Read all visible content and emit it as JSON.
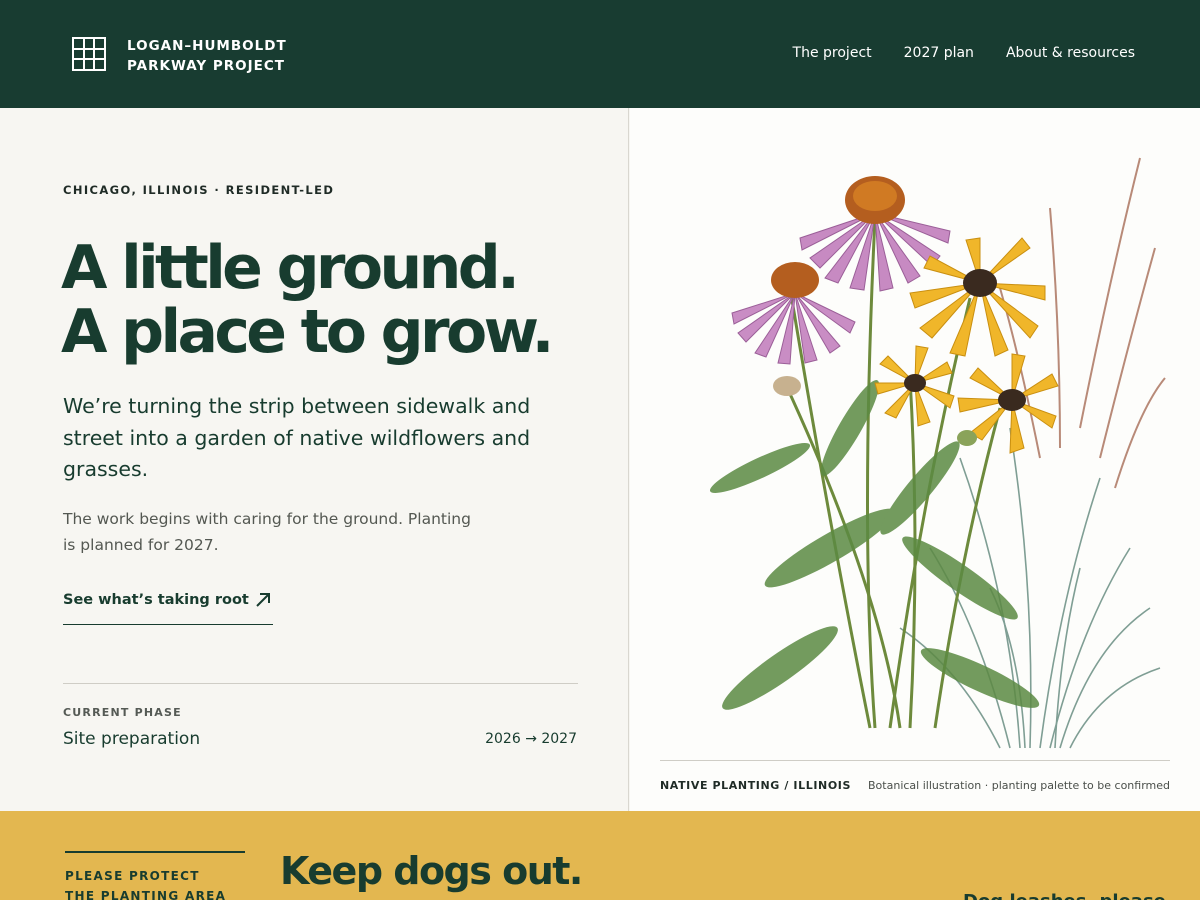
{
  "header": {
    "brand_line1": "LOGAN–HUMBOLDT",
    "brand_line2": "PARKWAY PROJECT",
    "nav": [
      "The project",
      "2027 plan",
      "About & resources"
    ]
  },
  "hero": {
    "eyebrow": "CHICAGO, ILLINOIS · RESIDENT-LED",
    "headline_line1": "A little ground.",
    "headline_line2": "A place to grow.",
    "lead": "We’re turning the strip between sidewalk and street into a garden of native wildflowers and grasses.",
    "sub": "The work begins with caring for the ground. Planting is planned for 2027.",
    "cta_label": "See what’s taking root",
    "phase_label": "CURRENT PHASE",
    "phase_value": "Site preparation",
    "phase_dates": "2026 → 2027"
  },
  "illustration": {
    "caption_left": "NATIVE PLANTING / ILLINOIS",
    "caption_right": "Botanical illustration · planting palette to be confirmed"
  },
  "notice": {
    "label_line1": "PLEASE PROTECT",
    "label_line2": "THE PLANTING AREA",
    "title": "Keep dogs out.",
    "right_text": "Dog leashes, please"
  },
  "colors": {
    "header_bg": "#183c31",
    "accent_green": "#183c2f",
    "band_yellow": "#e3b750",
    "page_bg": "#f7f6f2"
  }
}
